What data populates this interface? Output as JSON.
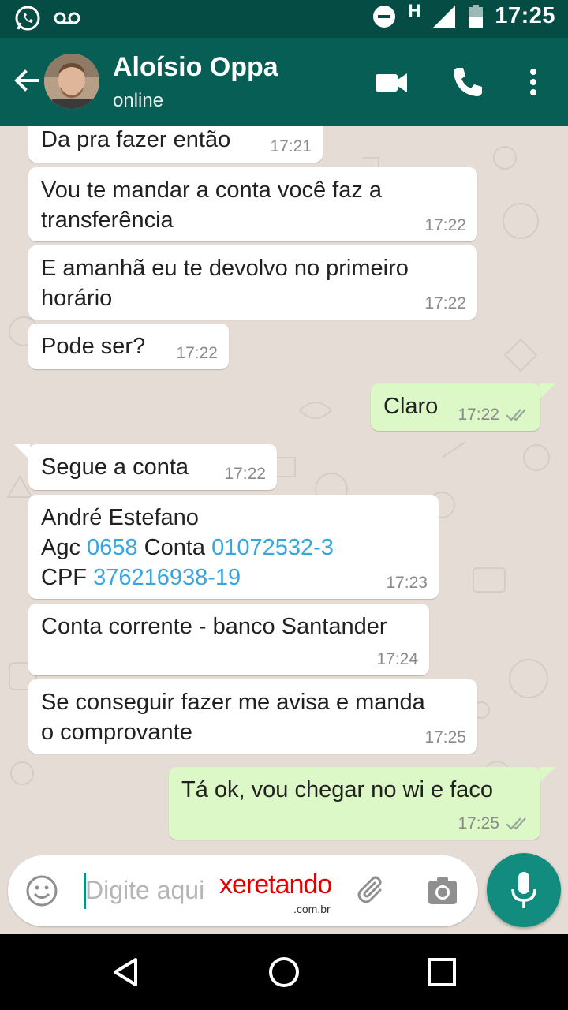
{
  "status_bar": {
    "time": "17:25",
    "network_label": "H",
    "icons": [
      "whatsapp-icon",
      "voicemail-icon",
      "do-not-disturb-icon",
      "signal-icon",
      "battery-icon"
    ]
  },
  "header": {
    "contact_name": "Aloísio Oppa",
    "status": "online",
    "icons": [
      "back-arrow-icon",
      "video-call-icon",
      "phone-icon",
      "more-options-icon"
    ]
  },
  "messages": [
    {
      "id": "m1",
      "direction": "in",
      "text": "Da pra fazer então",
      "time": "17:21"
    },
    {
      "id": "m2",
      "direction": "in",
      "lines": [
        "Vou te mandar a conta você faz a",
        "transferência"
      ],
      "time": "17:22"
    },
    {
      "id": "m3",
      "direction": "in",
      "lines": [
        "E amanhã eu te devolvo no primeiro",
        "horário"
      ],
      "time": "17:22"
    },
    {
      "id": "m4",
      "direction": "in",
      "text": "Pode ser?",
      "time": "17:22"
    },
    {
      "id": "m5",
      "direction": "out",
      "text": "Claro",
      "time": "17:22",
      "read": true
    },
    {
      "id": "m6",
      "direction": "in",
      "text": "Segue a conta",
      "time": "17:22"
    },
    {
      "id": "m7",
      "direction": "in",
      "name": "André Estefano",
      "agc_label": "Agc",
      "agc": "0658",
      "conta_label": "Conta",
      "conta": "01072532-3",
      "cpf_label": "CPF",
      "cpf": "376216938-19",
      "time": "17:23"
    },
    {
      "id": "m8",
      "direction": "in",
      "text": "Conta corrente - banco Santander",
      "time": "17:24"
    },
    {
      "id": "m9",
      "direction": "in",
      "lines": [
        "Se conseguir fazer me avisa e manda",
        "o comprovante"
      ],
      "time": "17:25"
    },
    {
      "id": "m10",
      "direction": "out",
      "text": "Tá ok, vou chegar no wi  e faco",
      "time": "17:25",
      "read": true
    }
  ],
  "composer": {
    "placeholder": "Digite aqui",
    "watermark": "xeretando",
    "watermark_sub": ".com.br",
    "icons": [
      "emoji-icon",
      "attach-icon",
      "camera-icon",
      "microphone-icon"
    ]
  },
  "colors": {
    "toolbar": "#075e54",
    "status_bar": "#054d44",
    "incoming_bubble": "#ffffff",
    "outgoing_bubble": "#dcf8c6",
    "chat_background": "#e5ddd5",
    "link": "#3aa4dd",
    "accent": "#128c7e"
  },
  "nav_bar": {
    "icons": [
      "back-triangle-icon",
      "home-circle-icon",
      "recents-square-icon"
    ]
  }
}
